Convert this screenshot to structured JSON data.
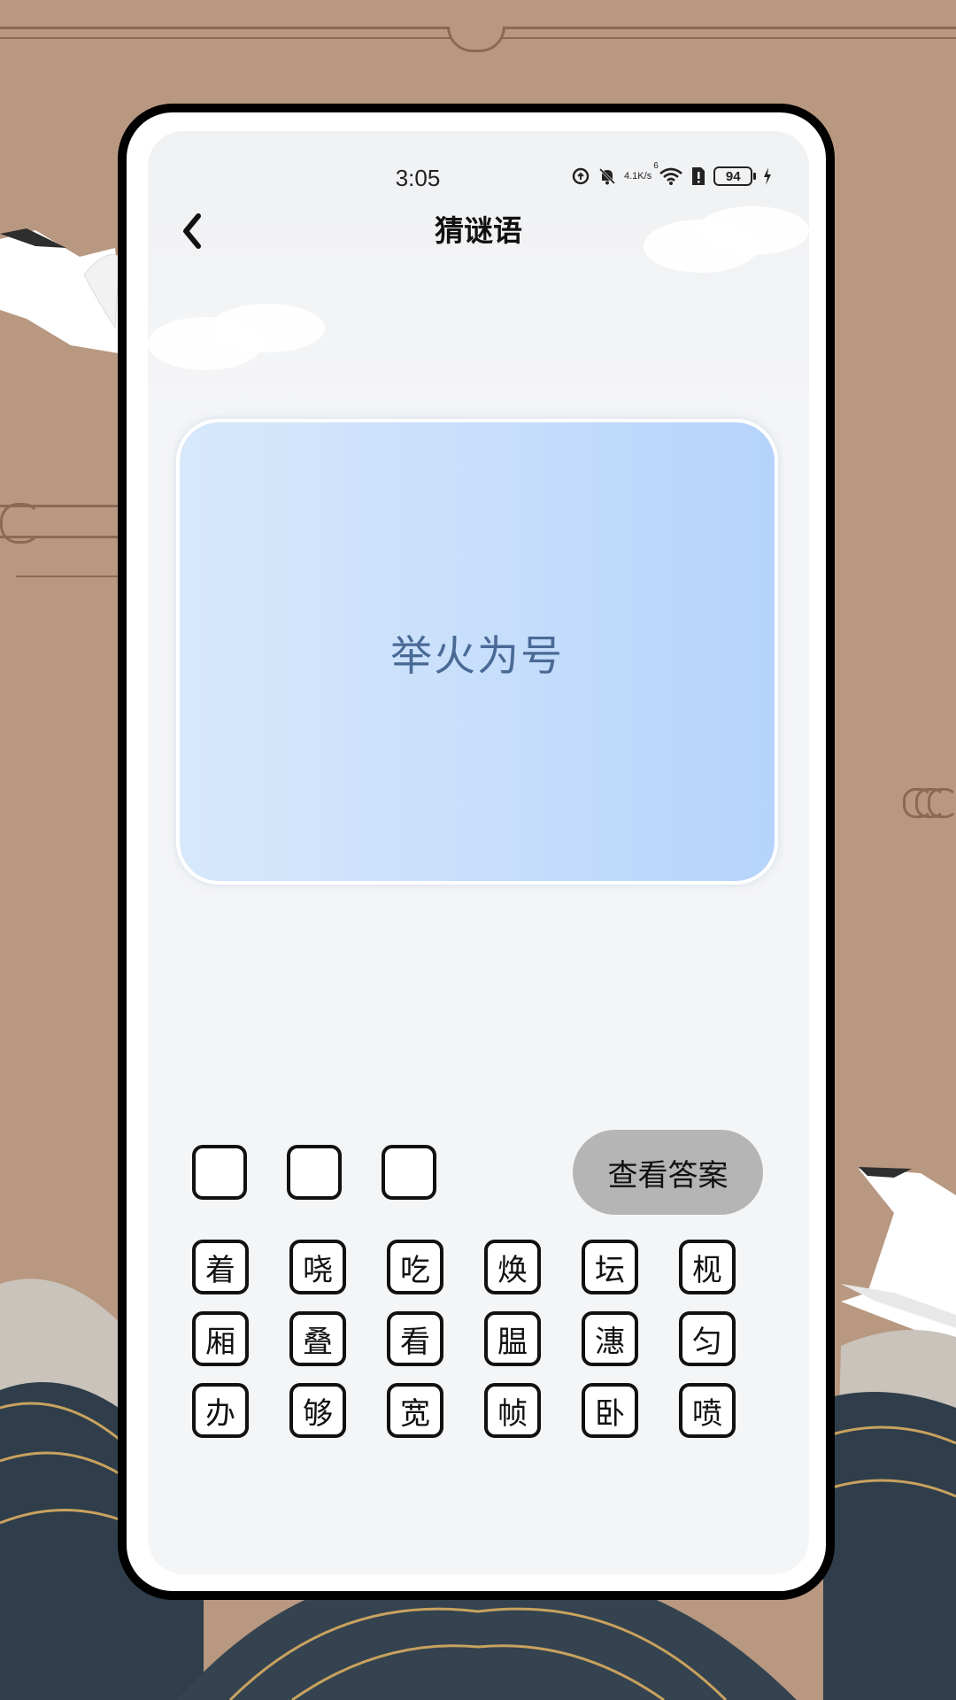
{
  "status_bar": {
    "time": "3:05",
    "net_speed_value": "4.1",
    "net_speed_unit": "K/s",
    "wifi_label": "6",
    "battery": "94"
  },
  "header": {
    "title": "猜谜语"
  },
  "riddle": {
    "text": "举火为号"
  },
  "answer": {
    "slots": [
      "",
      "",
      ""
    ],
    "view_answer_label": "查看答案"
  },
  "characters": [
    "着",
    "哓",
    "吃",
    "焕",
    "坛",
    "枧",
    "厢",
    "叠",
    "看",
    "腽",
    "潓",
    "匀",
    "办",
    "够",
    "宽",
    "帧",
    "卧",
    "喷"
  ],
  "colors": {
    "background": "#b89880",
    "card_gradient_start": "#d7e8fb",
    "card_gradient_end": "#b6d3fb",
    "riddle_text": "#4a6a96",
    "button_gray": "#b5b5b5"
  },
  "icons": {
    "back": "chevron-left-icon",
    "status": [
      "data-saver-icon",
      "mute-icon",
      "wifi-icon",
      "sim-alert-icon",
      "battery-icon",
      "charging-icon"
    ]
  }
}
